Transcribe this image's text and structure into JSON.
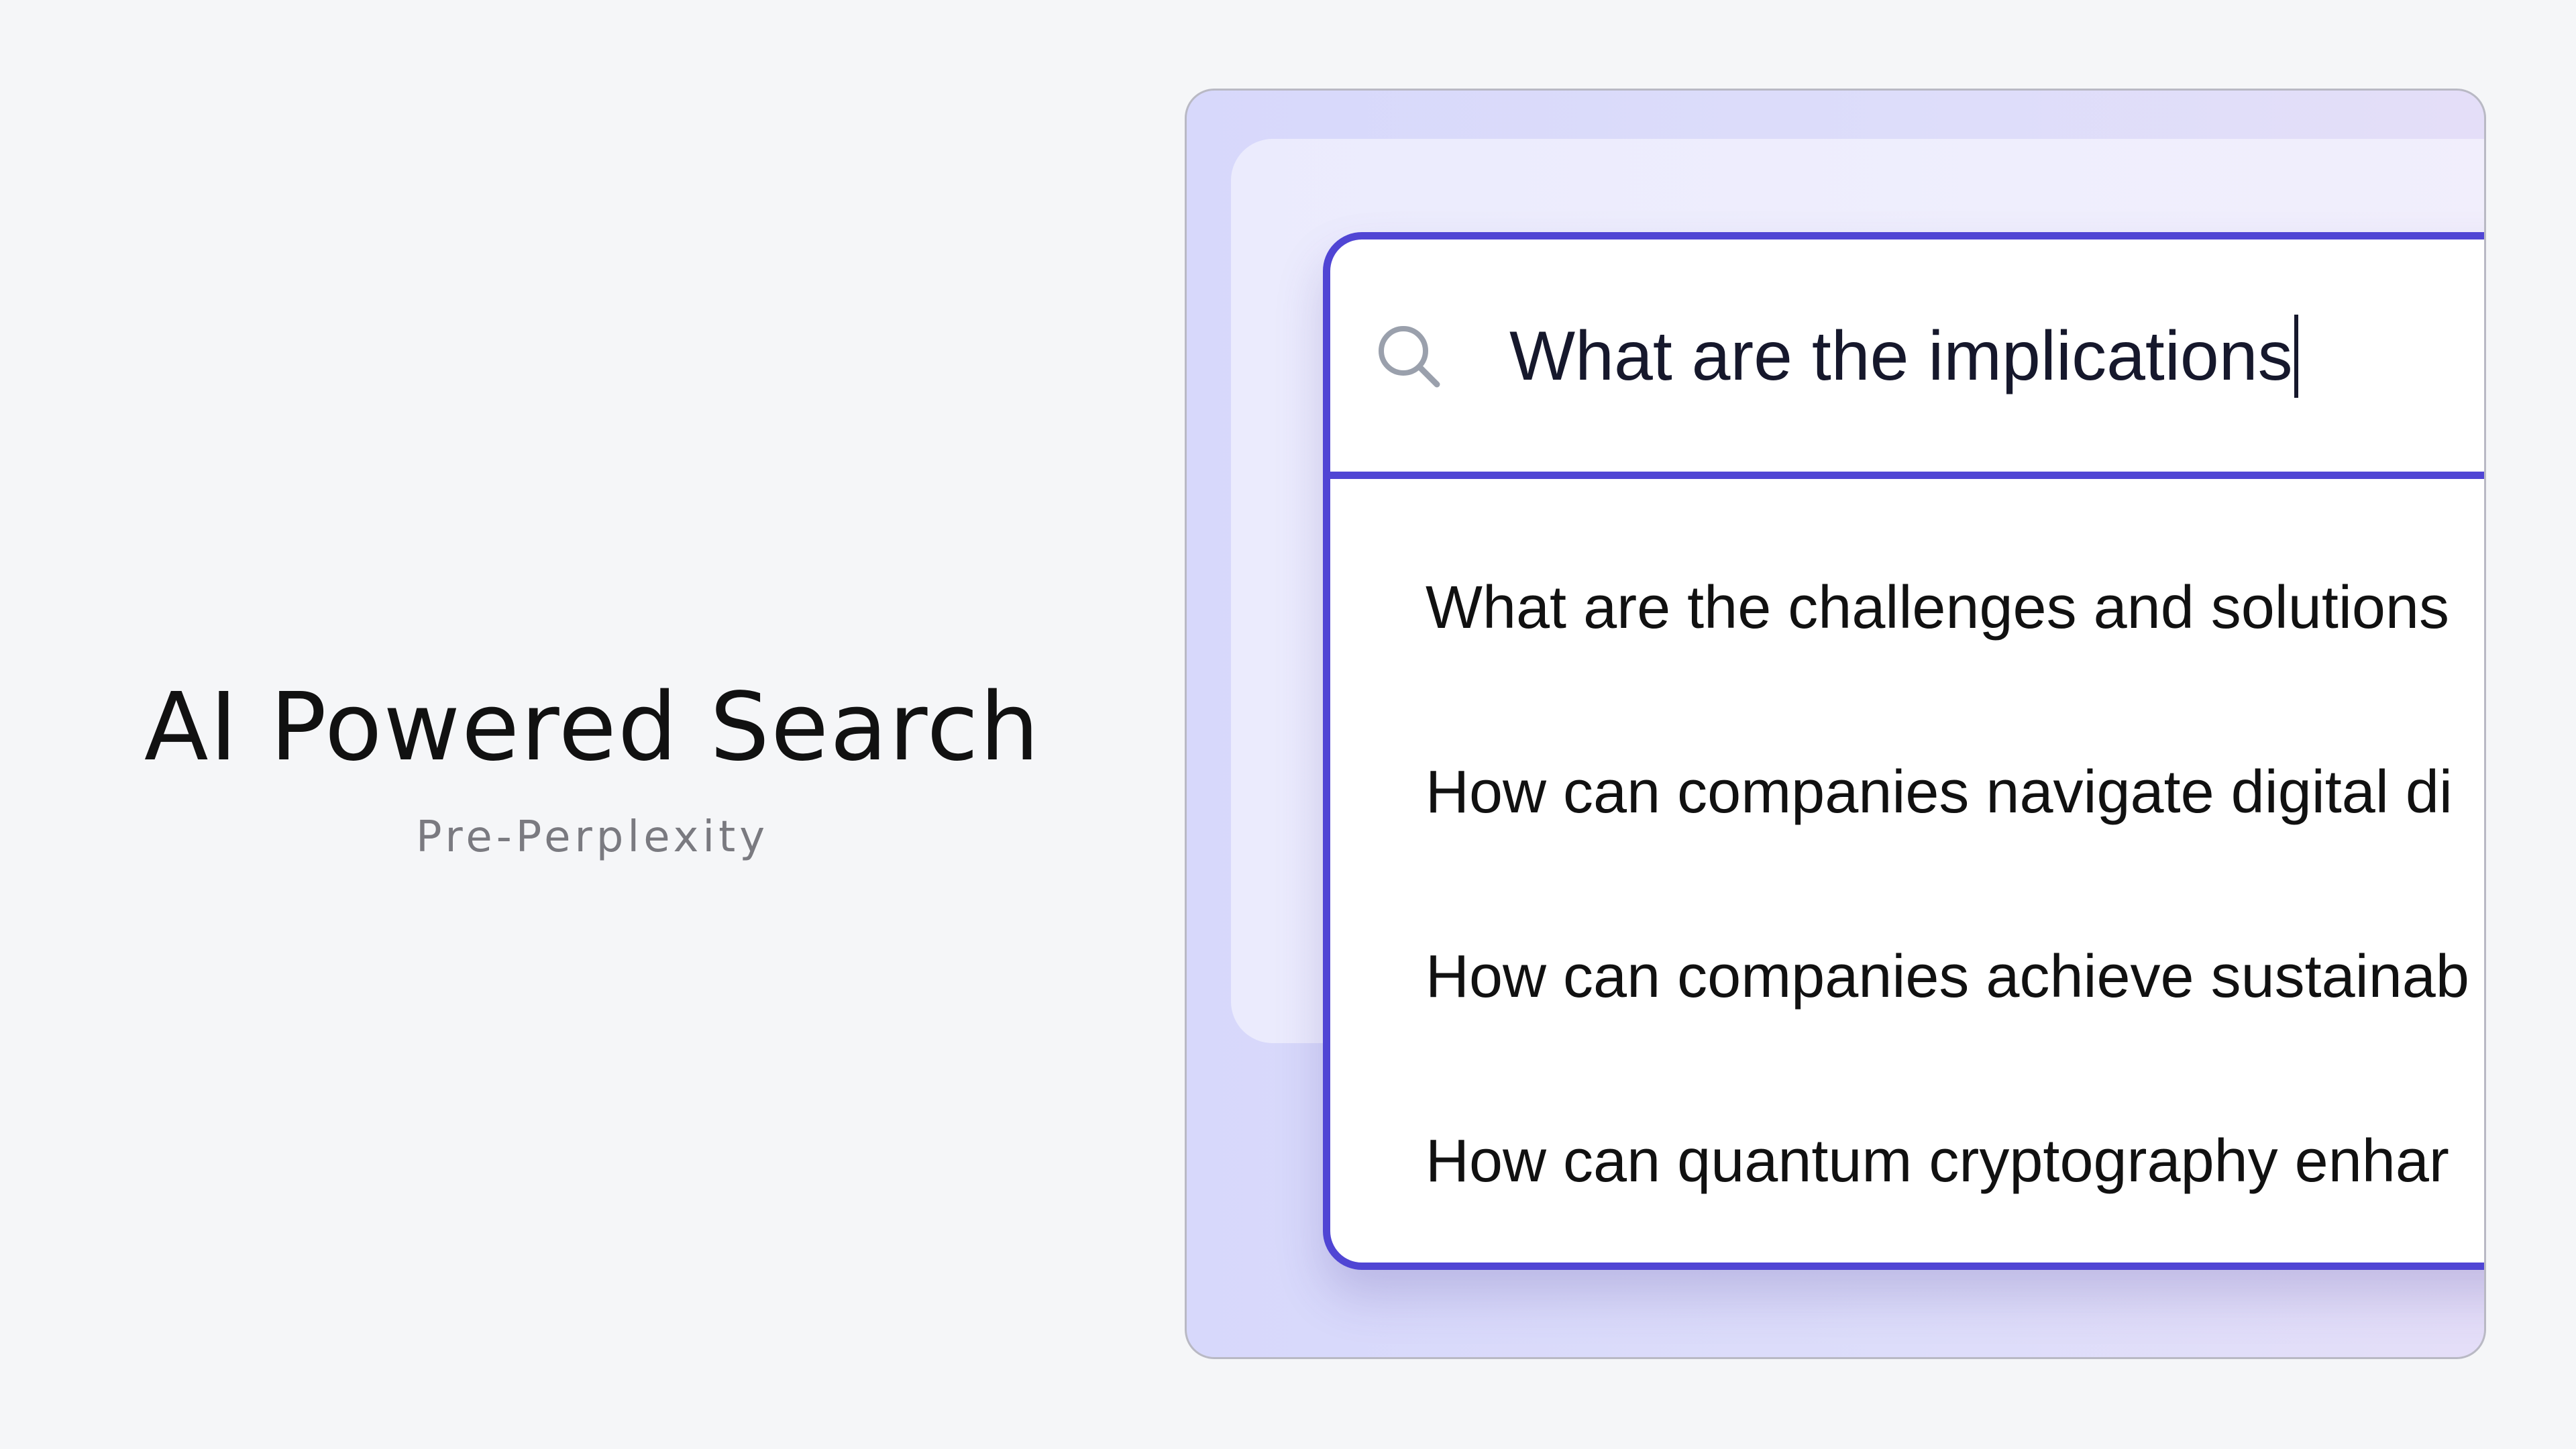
{
  "hero": {
    "title": "AI Powered Search",
    "subtitle": "Pre-Perplexity"
  },
  "search": {
    "query": "What are the implications",
    "icon": "search-icon"
  },
  "suggestions": [
    "What are the challenges and solutions",
    "How can companies navigate digital di",
    "How can companies achieve sustainab",
    "How can quantum cryptography enhar"
  ],
  "colors": {
    "accent": "#5045d4",
    "page_background": "#f5f6f8",
    "showcase_background": "#d7d8fb",
    "title_text": "#111111",
    "subtitle_text": "#7a7a80"
  }
}
